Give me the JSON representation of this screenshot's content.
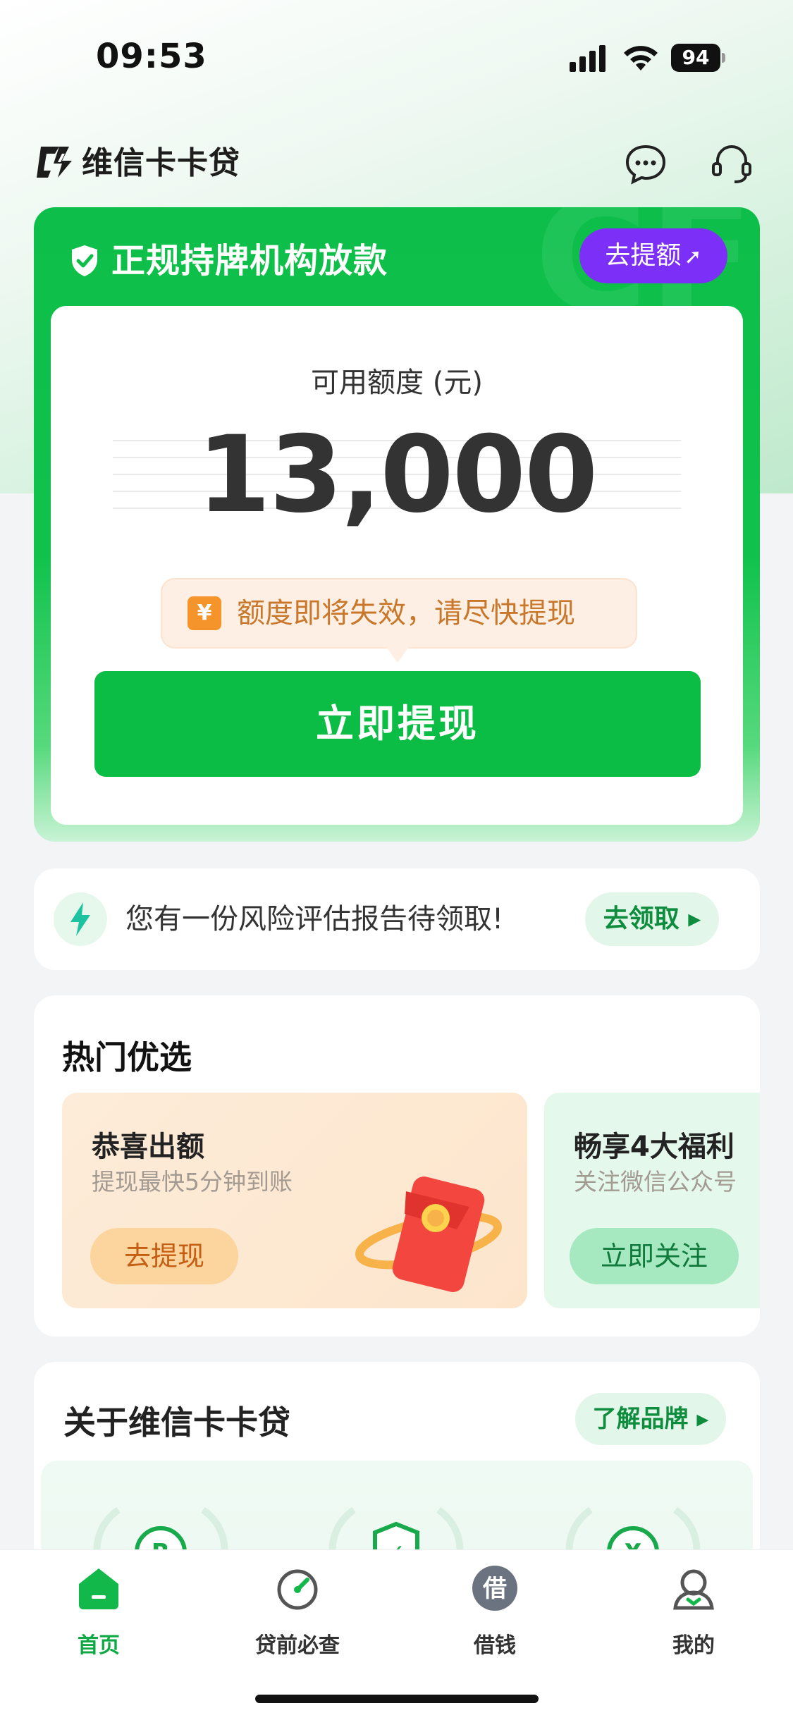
{
  "status_bar": {
    "time": "09:53",
    "battery": "94"
  },
  "header": {
    "app_name": "维信卡卡贷",
    "icons": [
      "chat-icon",
      "customer-service-icon"
    ]
  },
  "quota_card": {
    "license_text": "正规持牌机构放款",
    "raise_label": "去提额",
    "available_label": "可用额度 (元)",
    "amount": "13,000",
    "tip": "额度即将失效，请尽快提现",
    "tip_icon": "¥",
    "withdraw_label": "立即提现"
  },
  "risk_banner": {
    "text": "您有一份风险评估报告待领取!",
    "button": "去领取"
  },
  "hot": {
    "title": "热门优选",
    "promos": [
      {
        "title": "恭喜出额",
        "subtitle": "提现最快5分钟到账",
        "button": "去提现"
      },
      {
        "title": "畅享4大福利",
        "subtitle": "关注微信公众号",
        "button": "立即关注"
      }
    ]
  },
  "about": {
    "title": "关于维信卡卡贷",
    "button": "了解品牌",
    "badges": [
      "R",
      "✓",
      "¥"
    ]
  },
  "tabs": [
    {
      "label": "首页",
      "icon": "home-icon",
      "active": true
    },
    {
      "label": "贷前必查",
      "icon": "gauge-icon",
      "active": false
    },
    {
      "label": "借钱",
      "icon": "borrow-icon",
      "glyph": "借",
      "active": false
    },
    {
      "label": "我的",
      "icon": "profile-icon",
      "active": false
    }
  ],
  "colors": {
    "brand_green": "#0cbd45",
    "purple": "#7b2ff7",
    "orange": "#f5942a"
  }
}
